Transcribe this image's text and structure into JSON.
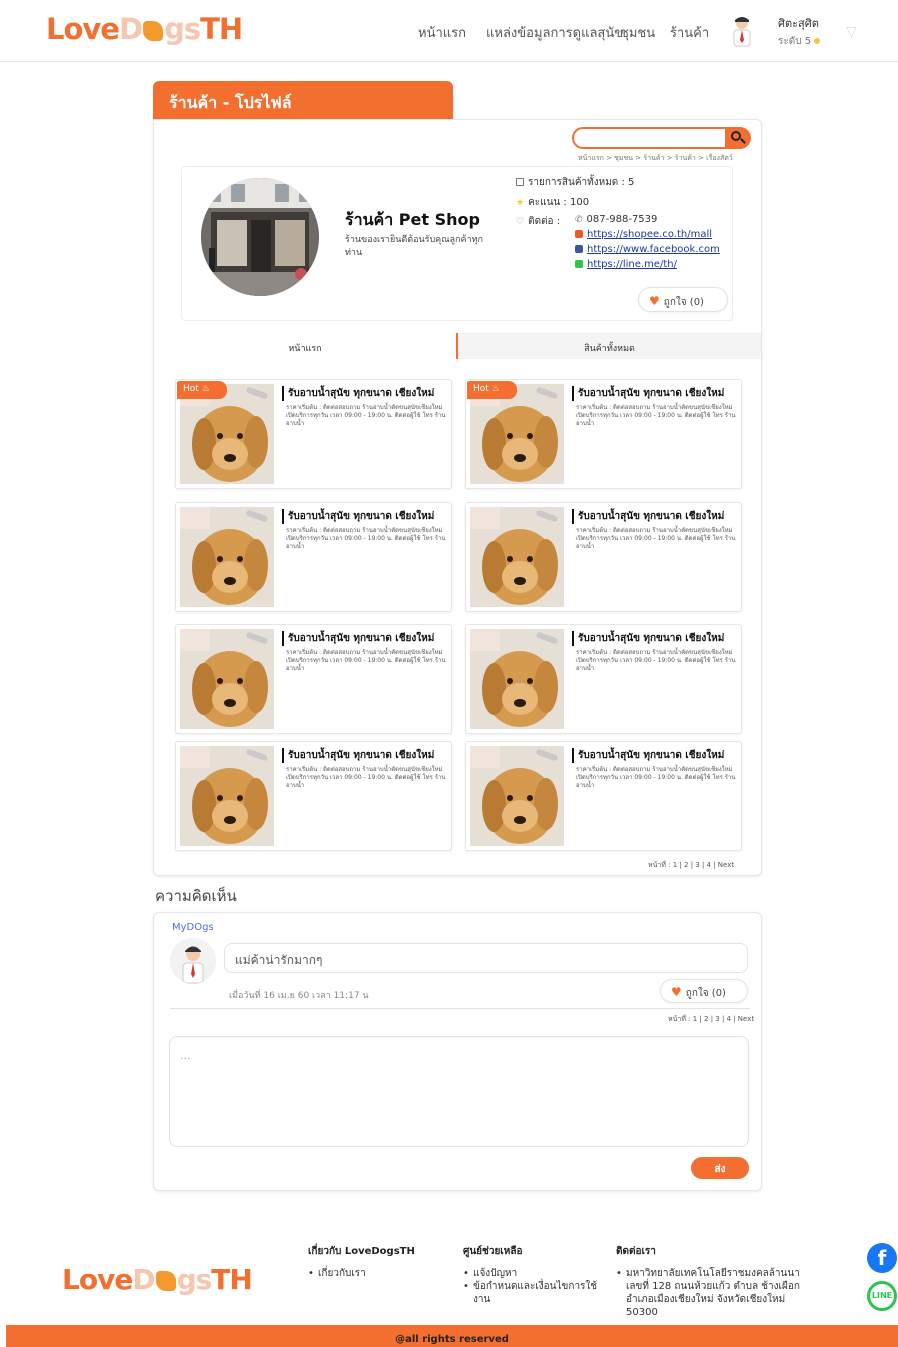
{
  "header": {
    "logo_text_a": "Love",
    "logo_text_b": "D",
    "logo_text_c": "gs",
    "logo_text_d": "TH",
    "nav": [
      "หน้าแรก",
      "แหล่งข้อมูลการดูแลสุนัข",
      "ชุมชน",
      "ร้านค้า"
    ],
    "user_name": "ศิตะสุศิต",
    "user_level": "ระดับ 5"
  },
  "page": {
    "tab_title": "ร้านค้า - โปรไฟล์",
    "breadcrumb": "หน้าแรก > ชุมชน > ร้านค้า > ร้านค้า > เรื่องสัตว์"
  },
  "shop": {
    "name": "ร้านค้า Pet Shop",
    "desc": "ร้านของเรายินดีต้อนรับคุณลูกค้าทุกท่าน",
    "total_products": "รายการสินค้าทั้งหมด : 5",
    "score": "คะแนน : 100",
    "contact_label": "ติดต่อ :",
    "phone": "087-988-7539",
    "link_shopee": "https://shopee.co.th/mall",
    "link_facebook": "https://www.facebook.com",
    "link_line": "https://line.me/th/",
    "like_label": "ถูกใจ (0)"
  },
  "tabs": {
    "home": "หน้าแรก",
    "all": "สินค้าทั้งหมด"
  },
  "products": [
    {
      "hot": "Hot",
      "title": "รับอาบน้ำสุนัข ทุกขนาด เชียงใหม่",
      "body": "ราคาเริ่มต้น : ติดต่อสอบถาม ร้านอาบน้ำตัดขนสุนัขเชียงใหม่ เปิดบริการทุกวัน เวลา 09:00 - 19:00 น. ติดต่อผู้ใช้ โทร ร้านอาบน้ำ"
    },
    {
      "hot": "Hot",
      "title": "รับอาบน้ำสุนัข ทุกขนาด เชียงใหม่",
      "body": "ราคาเริ่มต้น : ติดต่อสอบถาม ร้านอาบน้ำตัดขนสุนัขเชียงใหม่ เปิดบริการทุกวัน เวลา 09:00 - 19:00 น. ติดต่อผู้ใช้ โทร ร้านอาบน้ำ"
    },
    {
      "hot": "",
      "title": "รับอาบน้ำสุนัข ทุกขนาด เชียงใหม่",
      "body": "ราคาเริ่มต้น : ติดต่อสอบถาม ร้านอาบน้ำตัดขนสุนัขเชียงใหม่ เปิดบริการทุกวัน เวลา 09:00 - 19:00 น. ติดต่อผู้ใช้ โทร ร้านอาบน้ำ"
    },
    {
      "hot": "",
      "title": "รับอาบน้ำสุนัข ทุกขนาด เชียงใหม่",
      "body": "ราคาเริ่มต้น : ติดต่อสอบถาม ร้านอาบน้ำตัดขนสุนัขเชียงใหม่ เปิดบริการทุกวัน เวลา 09:00 - 19:00 น. ติดต่อผู้ใช้ โทร ร้านอาบน้ำ"
    },
    {
      "hot": "",
      "title": "รับอาบน้ำสุนัข ทุกขนาด เชียงใหม่",
      "body": "ราคาเริ่มต้น : ติดต่อสอบถาม ร้านอาบน้ำตัดขนสุนัขเชียงใหม่ เปิดบริการทุกวัน เวลา 09:00 - 19:00 น. ติดต่อผู้ใช้ โทร ร้านอาบน้ำ"
    },
    {
      "hot": "",
      "title": "รับอาบน้ำสุนัข ทุกขนาด เชียงใหม่",
      "body": "ราคาเริ่มต้น : ติดต่อสอบถาม ร้านอาบน้ำตัดขนสุนัขเชียงใหม่ เปิดบริการทุกวัน เวลา 09:00 - 19:00 น. ติดต่อผู้ใช้ โทร ร้านอาบน้ำ"
    },
    {
      "hot": "",
      "title": "รับอาบน้ำสุนัข ทุกขนาด เชียงใหม่",
      "body": "ราคาเริ่มต้น : ติดต่อสอบถาม ร้านอาบน้ำตัดขนสุนัขเชียงใหม่ เปิดบริการทุกวัน เวลา 09:00 - 19:00 น. ติดต่อผู้ใช้ โทร ร้านอาบน้ำ"
    },
    {
      "hot": "",
      "title": "รับอาบน้ำสุนัข ทุกขนาด เชียงใหม่",
      "body": "ราคาเริ่มต้น : ติดต่อสอบถาม ร้านอาบน้ำตัดขนสุนัขเชียงใหม่ เปิดบริการทุกวัน เวลา 09:00 - 19:00 น. ติดต่อผู้ใช้ โทร ร้านอาบน้ำ"
    }
  ],
  "products_pager": "หน้าที่ : 1 | 2 | 3 | 4 | Next",
  "comments": {
    "title": "ความคิดเห็น",
    "commenter": "MyDOgs",
    "text": "แม่ค้าน่ารักมากๆ",
    "date": "เมื่อวันที่ 16 เม.ย 60 เวลา 11:17 น",
    "like_label": "ถูกใจ (0)",
    "pager": "หน้าที่ : 1 | 2 | 3 | 4 | Next",
    "input_placeholder": "...",
    "send_label": "ส่ง"
  },
  "footer": {
    "about_title": "เกี่ยวกับ LoveDogsTH",
    "about_items": [
      "เกี่ยวกับเรา"
    ],
    "help_title": "ศูนย์ช่วยเหลือ",
    "help_items": [
      "แจ้งปัญหา",
      "ข้อกำหนดและเงื่อนไขการใช้งาน"
    ],
    "contact_title": "ติดต่อเรา",
    "contact_items": [
      "มหาวิทยาลัยเทคโนโลยีราชมงคลล้านนา เลขที่ 128 ถนนห้วยแก้ว ตำบล ช้างเผือก อำเภอเมืองเชียงใหม่ จังหวัดเชียงใหม่ 50300"
    ],
    "copyright": "@all rights reserved"
  },
  "colors": {
    "accent": "#f26f30",
    "link": "#1a3b9e"
  }
}
